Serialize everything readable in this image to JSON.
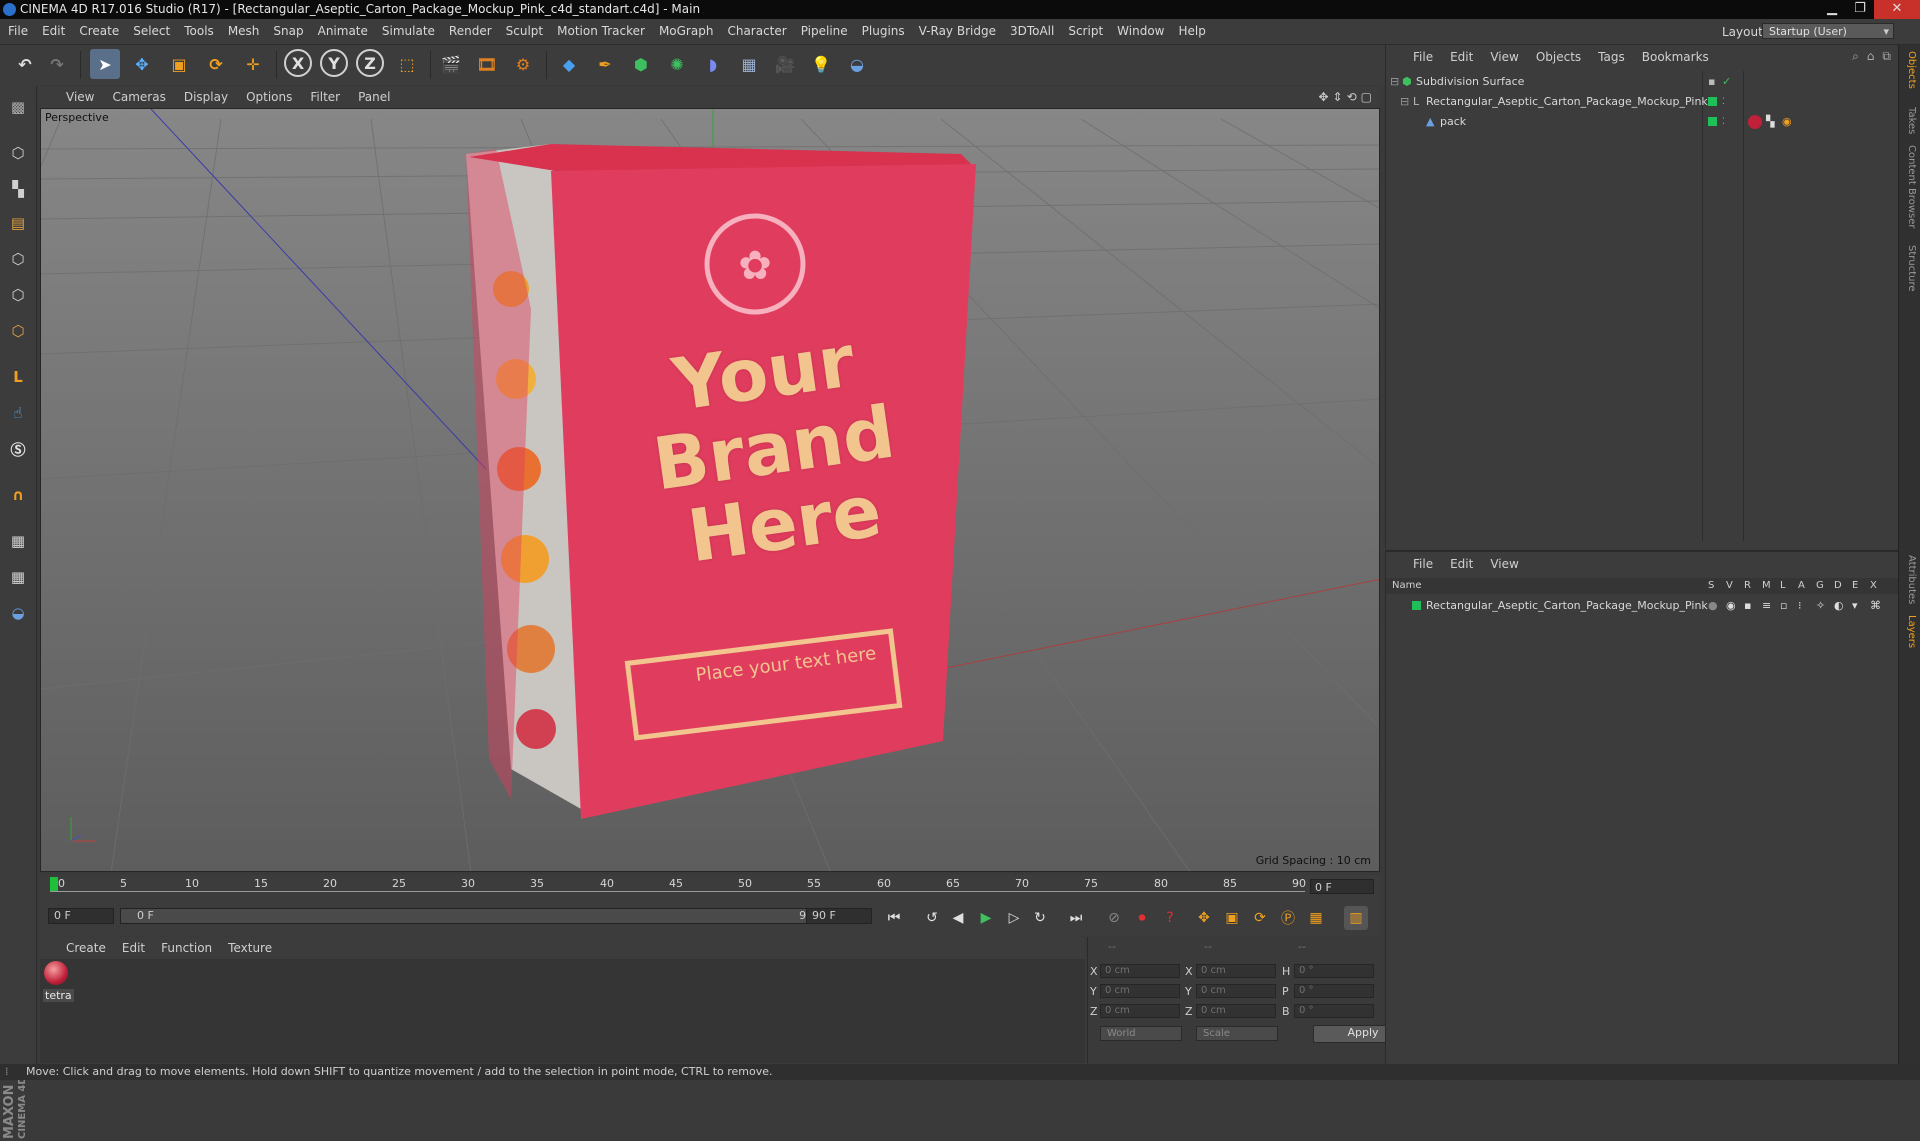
{
  "titlebar": {
    "title": "CINEMA 4D R17.016 Studio (R17) - [Rectangular_Aseptic_Carton_Package_Mockup_Pink_c4d_standart.c4d] - Main"
  },
  "menubar": {
    "items": [
      "File",
      "Edit",
      "Create",
      "Select",
      "Tools",
      "Mesh",
      "Snap",
      "Animate",
      "Simulate",
      "Render",
      "Sculpt",
      "Motion Tracker",
      "MoGraph",
      "Character",
      "Pipeline",
      "Plugins",
      "V-Ray Bridge",
      "3DToAll",
      "Script",
      "Window",
      "Help"
    ],
    "layout_label": "Layout:",
    "layout_value": "Startup (User)"
  },
  "toolbar_icons": [
    "undo-icon",
    "redo-icon",
    "select-arrow-icon",
    "move-icon",
    "scale-icon",
    "rotate-icon",
    "move-add-icon",
    "x-axis-icon",
    "y-axis-icon",
    "z-axis-icon",
    "world-coord-icon",
    "render-view-icon",
    "render-picture-viewer-icon",
    "render-settings-icon",
    "cube-icon",
    "pen-spline-icon",
    "nurbs-icon",
    "array-icon",
    "deformer-icon",
    "floor-icon",
    "camera-icon",
    "light-icon",
    "python-icon"
  ],
  "viewport": {
    "menu": [
      "View",
      "Cameras",
      "Display",
      "Options",
      "Filter",
      "Panel"
    ],
    "label": "Perspective",
    "grid_spacing": "Grid Spacing : 10 cm",
    "product": {
      "brand_line1": "Your",
      "brand_line2": "Brand",
      "brand_line3": "Here",
      "placeholder": "Place your text here",
      "color_main": "#e03d5e",
      "color_text": "#f2c58f"
    }
  },
  "timeline": {
    "ticks": [
      "0",
      "5",
      "10",
      "15",
      "20",
      "25",
      "30",
      "35",
      "40",
      "45",
      "50",
      "55",
      "60",
      "65",
      "70",
      "75",
      "80",
      "85",
      "90"
    ],
    "end_frame": "0 F",
    "start_field": "0 F",
    "range_start": "0 F",
    "range_end": "90 F",
    "end_field": "90 F"
  },
  "material_manager": {
    "menu": [
      "Create",
      "Edit",
      "Function",
      "Texture"
    ],
    "material_name": "tetra"
  },
  "coordinates": {
    "header": [
      "--",
      "--",
      "--"
    ],
    "rows": [
      {
        "l1": "X",
        "v1": "0 cm",
        "l2": "X",
        "v2": "0 cm",
        "l3": "H",
        "v3": "0 °"
      },
      {
        "l1": "Y",
        "v1": "0 cm",
        "l2": "Y",
        "v2": "0 cm",
        "l3": "P",
        "v3": "0 °"
      },
      {
        "l1": "Z",
        "v1": "0 cm",
        "l2": "Z",
        "v2": "0 cm",
        "l3": "B",
        "v3": "0 °"
      }
    ],
    "mode1": "World",
    "mode2": "Scale",
    "apply": "Apply"
  },
  "object_manager": {
    "menu": [
      "File",
      "Edit",
      "View",
      "Objects",
      "Tags",
      "Bookmarks"
    ],
    "objects": [
      {
        "name": "Subdivision Surface"
      },
      {
        "name": "Rectangular_Aseptic_Carton_Package_Mockup_Pink"
      },
      {
        "name": "pack"
      }
    ]
  },
  "layer_manager": {
    "menu": [
      "File",
      "Edit",
      "View"
    ],
    "columns": [
      "Name",
      "S",
      "V",
      "R",
      "M",
      "L",
      "A",
      "G",
      "D",
      "E",
      "X"
    ],
    "layer_name": "Rectangular_Aseptic_Carton_Package_Mockup_Pink"
  },
  "side_tabs": [
    "Objects",
    "Takes",
    "Content Browser",
    "Structure",
    "Attributes",
    "Layers"
  ],
  "status": "Move: Click and drag to move elements. Hold down SHIFT to quantize movement / add to the selection in point mode, CTRL to remove.",
  "branding": {
    "maxon": "MAXON",
    "cinema": "CINEMA 4D"
  }
}
